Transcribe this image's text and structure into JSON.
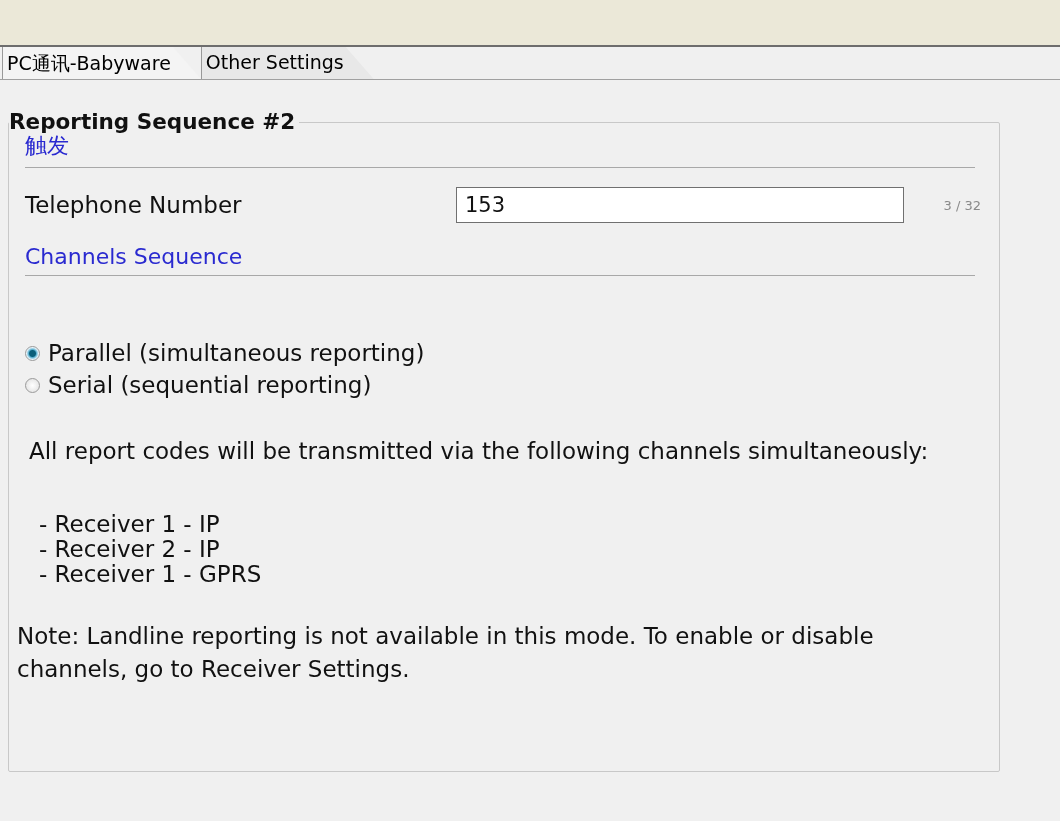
{
  "tabs": [
    {
      "label": "PC通讯-Babyware",
      "selected": true
    },
    {
      "label": "Other Settings",
      "selected": false
    }
  ],
  "group": {
    "title": "Reporting Sequence #2",
    "trigger_section": {
      "title": "触发"
    },
    "telephone": {
      "label": "Telephone Number",
      "value": "153",
      "counter": "3 / 32"
    },
    "channels_section": {
      "title": "Channels Sequence"
    },
    "modes": [
      {
        "label": "Parallel (simultaneous reporting)",
        "selected": true
      },
      {
        "label": "Serial (sequential reporting)",
        "selected": false
      }
    ],
    "description": "All report codes will be transmitted via the following channels simultaneously:",
    "channels": [
      "- Receiver 1 - IP",
      "- Receiver 2 - IP",
      "- Receiver 1 - GPRS"
    ],
    "note": "Note: Landline reporting is not available in this mode. To enable or disable channels, go to Receiver Settings."
  }
}
